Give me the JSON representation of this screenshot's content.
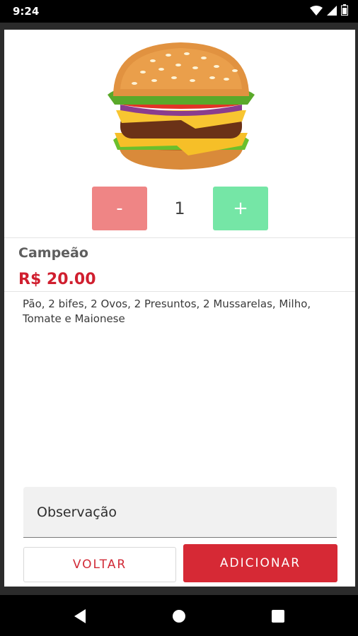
{
  "status_bar": {
    "time": "9:24",
    "icons": [
      "wifi-icon",
      "signal-icon",
      "battery-icon"
    ]
  },
  "product": {
    "image": "burger-image",
    "quantity": "1",
    "minus_label": "-",
    "plus_label": "+",
    "name": "Campeão",
    "price": "R$ 20.00",
    "description": "Pão, 2 bifes, 2 Ovos, 2 Presuntos, 2 Mussarelas, Milho, Tomate e Maionese"
  },
  "observation": {
    "label": "Observação"
  },
  "actions": {
    "back_label": "VOLTAR",
    "add_label": "ADICIONAR"
  },
  "navigation": {
    "icons": [
      "back-triangle-icon",
      "home-circle-icon",
      "recents-square-icon"
    ]
  },
  "colors": {
    "accent_red": "#d62935",
    "price_red": "#d01f2f",
    "minus_button": "#ef8585",
    "plus_button": "#75e6a6"
  }
}
